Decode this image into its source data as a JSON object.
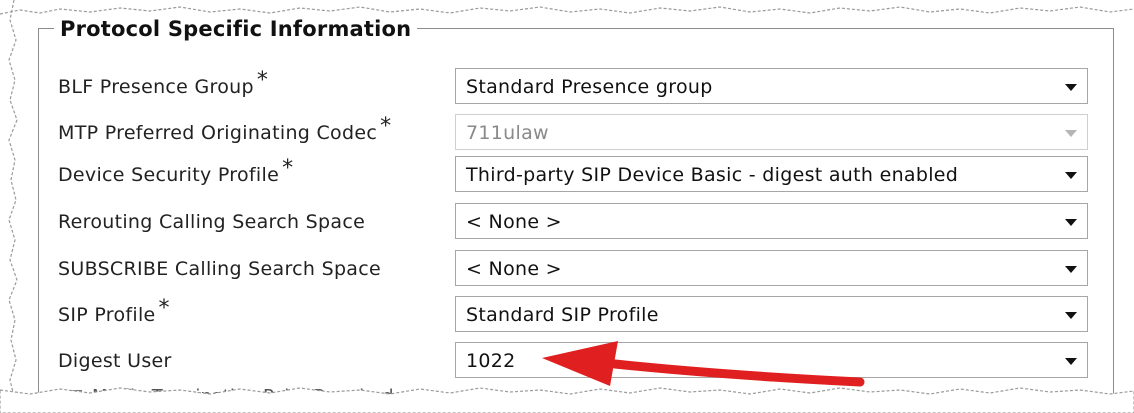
{
  "section": {
    "legend": "Protocol Specific Information"
  },
  "fields": [
    {
      "label": "BLF Presence Group",
      "required": "*",
      "value": "Standard Presence group",
      "disabled": false
    },
    {
      "label": "MTP Preferred Originating Codec",
      "required": "*",
      "value": "711ulaw",
      "disabled": true
    },
    {
      "label": "Device Security Profile",
      "required": "*",
      "value": "Third-party SIP Device Basic - digest auth enabled",
      "disabled": false
    },
    {
      "label": "Rerouting Calling Search Space",
      "required": "",
      "value": "< None >",
      "disabled": false
    },
    {
      "label": "SUBSCRIBE Calling Search Space",
      "required": "",
      "value": "< None >",
      "disabled": false
    },
    {
      "label": "SIP Profile",
      "required": "*",
      "value": "Standard SIP Profile",
      "disabled": false
    },
    {
      "label": "Digest User",
      "required": "",
      "value": "1022",
      "disabled": false
    }
  ],
  "partial_row": {
    "label": "Media Termination Point Required"
  },
  "colors": {
    "annotation_arrow": "#e02020",
    "border": "#8c8c8c"
  },
  "icons": {
    "dropdown": "chevron-down-icon",
    "annotation": "red-arrow-icon"
  }
}
